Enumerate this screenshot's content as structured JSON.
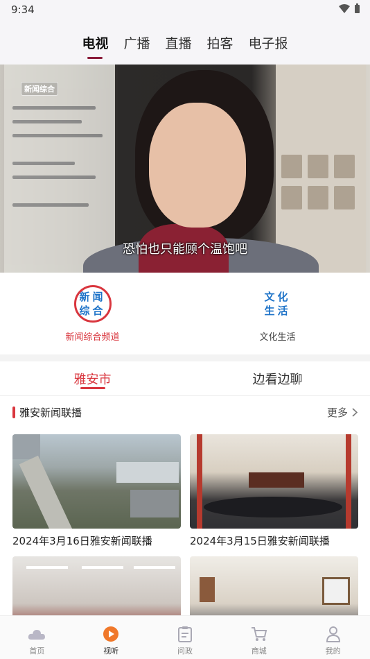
{
  "status_bar": {
    "time": "9:34"
  },
  "top_tabs": [
    {
      "label": "电视",
      "active": true
    },
    {
      "label": "广播",
      "active": false
    },
    {
      "label": "直播",
      "active": false
    },
    {
      "label": "拍客",
      "active": false
    },
    {
      "label": "电子报",
      "active": false
    }
  ],
  "video": {
    "channel_logo": "新闻综合",
    "subtitle": "恐怕也只能顾个温饱吧"
  },
  "channels": [
    {
      "logo_text": "新闻综合",
      "label": "新闻综合频道",
      "active": true
    },
    {
      "logo_text": "文化生活",
      "label": "文化生活",
      "active": false
    }
  ],
  "sub_tabs": [
    {
      "label": "雅安市",
      "active": true
    },
    {
      "label": "边看边聊",
      "active": false
    }
  ],
  "section": {
    "title": "雅安新闻联播",
    "more": "更多"
  },
  "cards": [
    {
      "title": "2024年3月16日雅安新闻联播"
    },
    {
      "title": "2024年3月15日雅安新闻联播"
    },
    {
      "title": ""
    },
    {
      "title": ""
    }
  ],
  "bottom_nav": [
    {
      "label": "首页",
      "icon": "cloud-icon",
      "active": false
    },
    {
      "label": "视听",
      "icon": "play-icon",
      "active": true
    },
    {
      "label": "问政",
      "icon": "clipboard-icon",
      "active": false
    },
    {
      "label": "商城",
      "icon": "cart-icon",
      "active": false
    },
    {
      "label": "我的",
      "icon": "user-icon",
      "active": false
    }
  ],
  "colors": {
    "accent": "#d9363e",
    "brand_orange": "#f0782a",
    "logo_blue": "#1e73c8"
  }
}
